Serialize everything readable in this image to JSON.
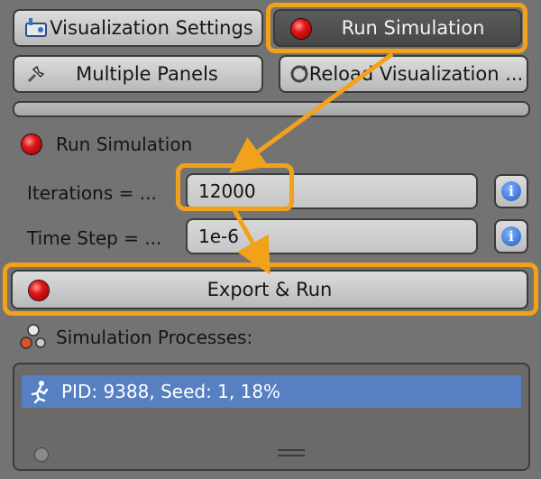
{
  "top_buttons": {
    "viz_settings": "Visualization Settings",
    "run_simulation": "Run Simulation",
    "multiple_panels": "Multiple Panels",
    "reload_visualization": "Reload Visualization ..."
  },
  "section_title": "Run Simulation",
  "fields": {
    "iterations_label": "Iterations = ...",
    "iterations_value": "12000",
    "time_step_label": "Time Step = ...",
    "time_step_value": "1e-6"
  },
  "export_run": "Export & Run",
  "processes": {
    "title": "Simulation Processes:",
    "items": [
      "PID: 9388, Seed: 1, 18%"
    ]
  },
  "colors": {
    "highlight": "#f2a21a",
    "selected_row": "#5680c2"
  }
}
